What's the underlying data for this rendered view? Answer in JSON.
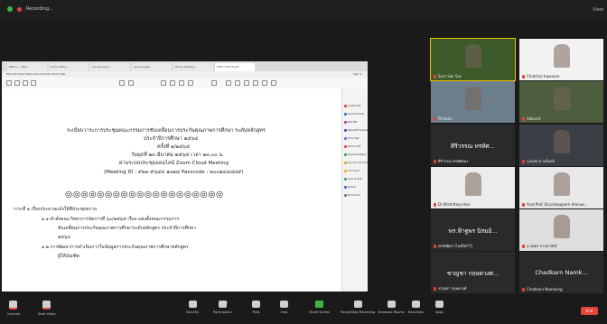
{
  "topbar": {
    "recording_label": "Recording...",
    "view_label": "View"
  },
  "browser": {
    "tabs": [
      "Office — MSU",
      "forms.office",
      "Google Docs",
      "docs.google",
      "Zoom Meeting",
      "ขอรับ รายงาน.pdf"
    ],
    "menu": "File  Edit  View  History  Bookmarks  Tools  Help",
    "sign_in": "Sign in"
  },
  "document": {
    "lines": [
      "ระเบียบวาระการประชุมคณะกรรมการขับเคลื่อนการประกันคุณภาพการศึกษา ระดับหลักสูตร",
      "ประจำปีการศึกษา ๒๕๖๔",
      "ครั้งที่ ๑/๒๕๖๕",
      "วันพุธที่ ๒๓ มีนาคม ๒๕๖๕ เวลา ๑๓.๐๐ น.",
      "ผ่านระบบประชุมออนไลน์ Zoom Cloud Meeting",
      "(Meeting ID : ๙๒๓ ๙๖๔๔ ๑๐๒๔ Passcode : ๒๐๐๒๔๔๘๔๙)"
    ],
    "ornaments": "◎◎◎◎◎◎◎◎◎◎◎◎◎◎◎◎◎◎◎◎",
    "agenda": [
      "วาระที่ ๑ เรื่องประธานแจ้งให้ที่ประชุมทราบ",
      "๑.๑ คำสั่งคณะวิทยาการจัดการที่ ๖๐/๒๕๖๕ เรื่อง แต่งตั้งคณะกรรมการ",
      "ขับเคลื่อนการประกันคุณภาพการศึกษาระดับหลักสูตร ประจำปีการศึกษา",
      "๒๕๖๔",
      "๑.๒ การพัฒนาการดำเนินการในข้อมูลการประกันคุณภาพการศึกษาหลักสูตร",
      "ผู้ให้บัณฑิต"
    ]
  },
  "sidebar_tools": [
    {
      "label": "Create PDF",
      "color": "#d9443a"
    },
    {
      "label": "Combine Files",
      "color": "#2f6cd8"
    },
    {
      "label": "Edit PDF",
      "color": "#c43bb0"
    },
    {
      "label": "Request E-signatures",
      "color": "#7b3ec8"
    },
    {
      "label": "Fill & Sign",
      "color": "#8b5cd6"
    },
    {
      "label": "Export PDF",
      "color": "#e0463a"
    },
    {
      "label": "Organize Pages",
      "color": "#3aa34a"
    },
    {
      "label": "Send for Comments",
      "color": "#d9a520"
    },
    {
      "label": "Comment",
      "color": "#e8b323"
    },
    {
      "label": "Scan & OCR",
      "color": "#2aa198"
    },
    {
      "label": "Protect",
      "color": "#3b6fd8"
    },
    {
      "label": "More Tools",
      "color": "#777777"
    }
  ],
  "participants": [
    {
      "name": "Sum Sak Sas",
      "big": "",
      "bg": "#3c5a2a"
    },
    {
      "name": "Chatchai  Inpanom",
      "big": "",
      "bg": "#f2f2f2"
    },
    {
      "name": "Pirawan",
      "big": "",
      "bg": "#6d7f8c"
    },
    {
      "name": "Akkarat",
      "big": "",
      "bg": "#4c5e3e"
    },
    {
      "name": "ศิริวรรณ ทรทัศตอง",
      "big": "ศิริวรรณ ทรทัศ...",
      "bg": "#2a2a2a"
    },
    {
      "name": "นงนภัส มานรีนงค์",
      "big": "",
      "bg": "#3a3f46"
    },
    {
      "name": "Dr.Wichittaya Kon",
      "big": "",
      "bg": "#ececec"
    },
    {
      "name": "Asst.Prof. Dr.prasopporn Amnua...",
      "big": "",
      "bg": "#e8e8e8"
    },
    {
      "name": "พรชัยฐิพร (ไมค์ปิดไว้)",
      "big": "พร.ฟ้าฐพร นิรมย์...",
      "bg": "#2a2a2a"
    },
    {
      "name": "อ.จตุพร ลาลลาสัตร์",
      "big": "",
      "bg": "#dedede"
    },
    {
      "name": "ชาญชา กฤษดวงศ์",
      "big": "ชาญชา กฤษดวงศ...",
      "bg": "#2a2a2a"
    },
    {
      "name": "Chadkarn  Namkung",
      "big": "Chadkarn  Namk...",
      "bg": "#2a2a2a"
    }
  ],
  "controls": [
    {
      "label": "Unmute",
      "icon": "microphone-icon"
    },
    {
      "label": "Start Video",
      "icon": "video-camera-icon"
    },
    {
      "label": "Security",
      "icon": "shield-icon"
    },
    {
      "label": "Participants",
      "icon": "participants-icon",
      "count": "12"
    },
    {
      "label": "Polls",
      "icon": "poll-icon"
    },
    {
      "label": "Chat",
      "icon": "chat-icon"
    },
    {
      "label": "Share Screen",
      "icon": "share-screen-icon"
    },
    {
      "label": "Pause/Stop Recording",
      "icon": "recording-icon"
    },
    {
      "label": "Breakout Rooms",
      "icon": "breakout-rooms-icon"
    },
    {
      "label": "Reactions",
      "icon": "reactions-icon"
    },
    {
      "label": "Apps",
      "icon": "apps-icon"
    }
  ],
  "end_label": "End",
  "colors": {
    "accent_green": "#3bb54a",
    "end_red": "#e0463a",
    "active_speaker": "#f2c200"
  }
}
